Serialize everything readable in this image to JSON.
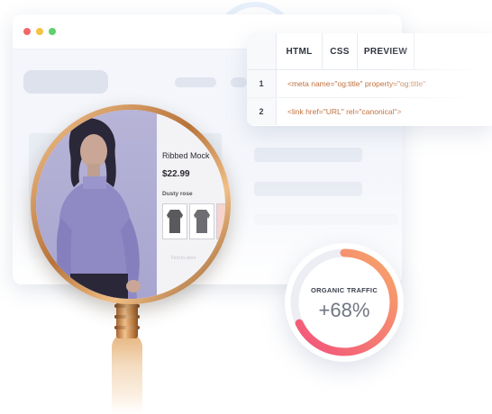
{
  "code_panel": {
    "tabs": [
      "HTML",
      "CSS",
      "PREVIEW"
    ],
    "lines": [
      {
        "number": "1",
        "code": "<meta name=\"og:title\" property=\"og:title\""
      },
      {
        "number": "2",
        "code": "<link href=\"URL\" rel=\"canonical\">"
      }
    ]
  },
  "product": {
    "name": "Ribbed Mock",
    "price": "$22.99",
    "color": "Dusty rose",
    "faint_text": "Find in store"
  },
  "traffic": {
    "label": "ORGANIC TRAFFIC",
    "value": "+68%",
    "fraction": 0.68
  },
  "colors": {
    "window_dot_red": "#f26868",
    "window_dot_yellow": "#f5c242",
    "window_dot_green": "#5fcf6a",
    "code_text": "#c0713f",
    "gauge_gradient_start": "#f2507b",
    "gauge_gradient_end": "#f7a86a",
    "photo_tint": "#aaa7d2"
  }
}
